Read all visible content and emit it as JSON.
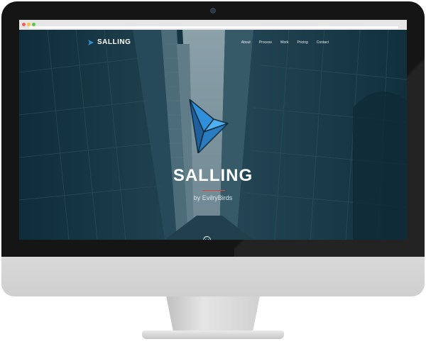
{
  "site": {
    "brand": "SALLING",
    "nav": [
      "About",
      "Process",
      "Work",
      "Pricing",
      "Contact"
    ],
    "hero_title": "SALLING",
    "hero_subtitle": "by EvilryBirds"
  },
  "icons": {
    "logo": "paper-bird-icon",
    "hero_logo": "origami-bird-icon",
    "scroll": "chevron-down-circle-icon"
  },
  "colors": {
    "accent": "#2f8fd8",
    "accent_dark": "#1f5f9c",
    "rule": "#d8473a",
    "text": "#ffffff"
  }
}
